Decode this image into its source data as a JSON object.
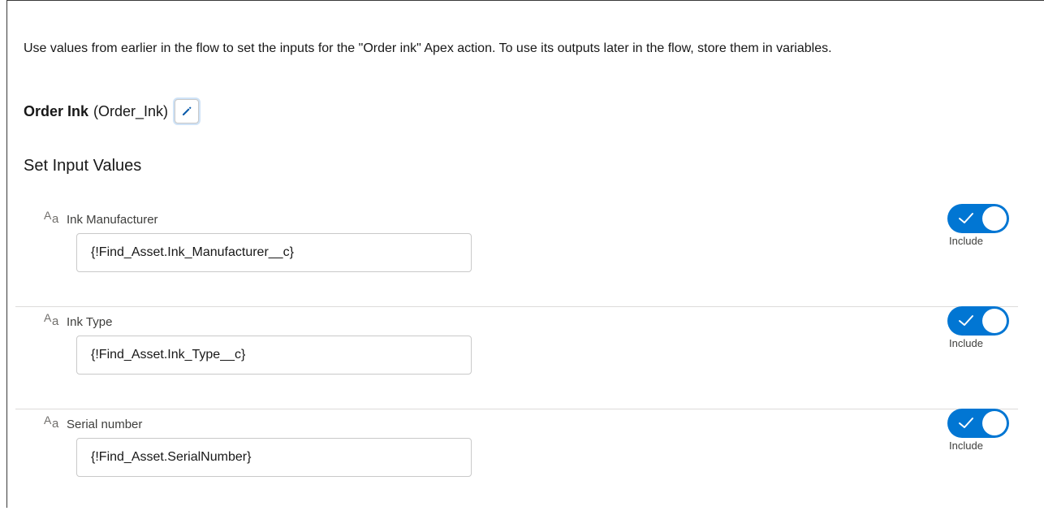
{
  "description": "Use values from earlier in the flow to set the inputs for the \"Order ink\" Apex action. To use its outputs later in the flow, store them in variables.",
  "action": {
    "label": "Order Ink",
    "api_name": "(Order_Ink)",
    "edit_icon": "pencil-icon"
  },
  "section_title": "Set Input Values",
  "accent_color": "#0176d3",
  "parameters": [
    {
      "type_icon": "text-type-icon",
      "type_glyph_big": "A",
      "type_glyph_small": "a",
      "label": "Ink Manufacturer",
      "value": "{!Find_Asset.Ink_Manufacturer__c}",
      "include": true,
      "include_label": "Include"
    },
    {
      "type_icon": "text-type-icon",
      "type_glyph_big": "A",
      "type_glyph_small": "a",
      "label": "Ink Type",
      "value": "{!Find_Asset.Ink_Type__c}",
      "include": true,
      "include_label": "Include"
    },
    {
      "type_icon": "text-type-icon",
      "type_glyph_big": "A",
      "type_glyph_small": "a",
      "label": "Serial number",
      "value": "{!Find_Asset.SerialNumber}",
      "include": true,
      "include_label": "Include"
    }
  ]
}
